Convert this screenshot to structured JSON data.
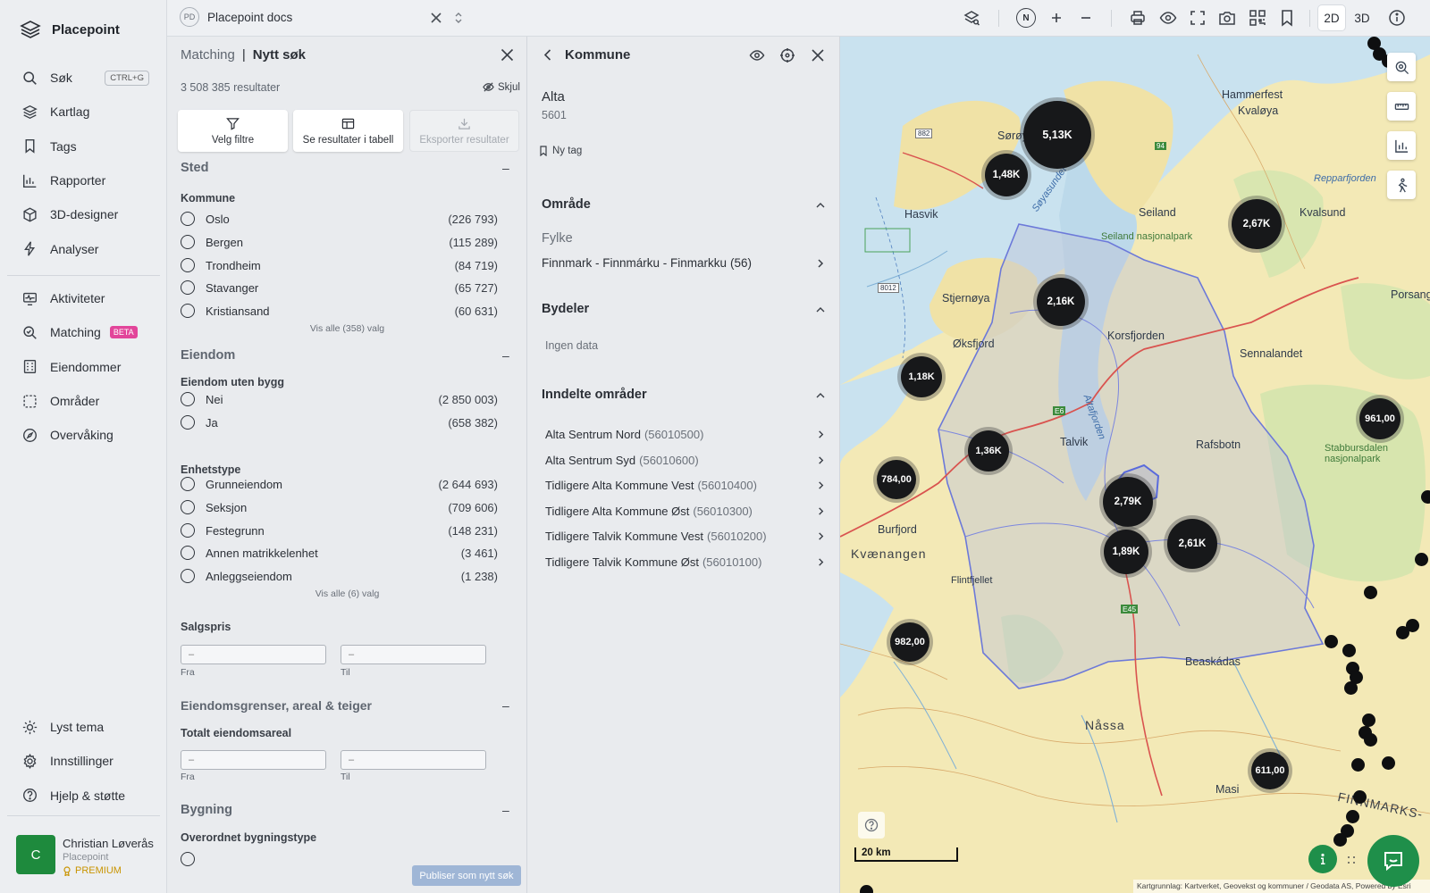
{
  "app": {
    "name": "Placepoint"
  },
  "sidebar": {
    "items": [
      {
        "label": "Søk",
        "icon": "search-icon",
        "shortcut": "CTRL+G"
      },
      {
        "label": "Kartlag",
        "icon": "layers-icon"
      },
      {
        "label": "Tags",
        "icon": "bookmark-icon"
      },
      {
        "label": "Rapporter",
        "icon": "bar-chart-icon"
      },
      {
        "label": "3D-designer",
        "icon": "cube-icon"
      },
      {
        "label": "Analyser",
        "icon": "bolt-icon"
      }
    ],
    "items2": [
      {
        "label": "Aktiviteter",
        "icon": "monitor-pulse-icon"
      },
      {
        "label": "Matching",
        "icon": "search-match-icon",
        "badge": "BETA"
      },
      {
        "label": "Eiendommer",
        "icon": "building-icon"
      },
      {
        "label": "Områder",
        "icon": "dashed-square-icon"
      },
      {
        "label": "Overvåking",
        "icon": "compass-icon"
      }
    ],
    "bottom": [
      {
        "label": "Lyst tema",
        "icon": "sun-icon"
      },
      {
        "label": "Innstillinger",
        "icon": "gear-icon"
      },
      {
        "label": "Hjelp & støtte",
        "icon": "question-circle-icon"
      }
    ],
    "user": {
      "initial": "C",
      "name": "Christian Løverås",
      "org": "Placepoint",
      "plan": "PREMIUM"
    }
  },
  "topbar": {
    "tab": {
      "badge": "PD",
      "title": "Placepoint docs"
    },
    "north_label": "N",
    "dim_2d": "2D",
    "dim_3d": "3D"
  },
  "matching": {
    "title_a": "Matching",
    "separator": "|",
    "title_b": "Nytt søk",
    "count": "3 508 385 resultater",
    "hide_label": "Skjul",
    "actions": [
      "Velg filtre",
      "Se resultater i tabell",
      "Eksporter resultater"
    ],
    "sections": {
      "sted": "Sted",
      "eiendom": "Eiendom",
      "grenser": "Eiendomsgrenser, areal & teiger",
      "bygning": "Bygning"
    },
    "collapse_symbol": "–",
    "kommune": {
      "label": "Kommune",
      "options": [
        {
          "name": "Oslo",
          "count": "(226 793)"
        },
        {
          "name": "Bergen",
          "count": "(115 289)"
        },
        {
          "name": "Trondheim",
          "count": "(84 719)"
        },
        {
          "name": "Stavanger",
          "count": "(65 727)"
        },
        {
          "name": "Kristiansand",
          "count": "(60 631)"
        }
      ],
      "more": "Vis alle (358) valg"
    },
    "uten_bygg": {
      "label": "Eiendom uten bygg",
      "options": [
        {
          "name": "Nei",
          "count": "(2 850 003)"
        },
        {
          "name": "Ja",
          "count": "(658 382)"
        }
      ]
    },
    "enhetstype": {
      "label": "Enhetstype",
      "options": [
        {
          "name": "Grunneiendom",
          "count": "(2 644 693)"
        },
        {
          "name": "Seksjon",
          "count": "(709 606)"
        },
        {
          "name": "Festegrunn",
          "count": "(148 231)"
        },
        {
          "name": "Annen matrikkelenhet",
          "count": "(3 461)"
        },
        {
          "name": "Anleggseiendom",
          "count": "(1 238)"
        }
      ],
      "more": "Vis alle (6) valg"
    },
    "salgspris": {
      "label": "Salgspris",
      "from_placeholder": "–",
      "to_placeholder": "–",
      "from": "Fra",
      "to": "Til"
    },
    "areal": {
      "label": "Totalt eiendomsareal",
      "from_placeholder": "–",
      "to_placeholder": "–",
      "from": "Fra",
      "to": "Til"
    },
    "bygning_sub": "Overordnet bygningstype",
    "publish": "Publiser som nytt søk"
  },
  "kommune_panel": {
    "title": "Kommune",
    "name": "Alta",
    "code": "5601",
    "tag": "Ny tag",
    "omrade": {
      "label": "Område",
      "fylke_label": "Fylke",
      "fylke": "Finnmark - Finnmárku - Finmarkku",
      "fylke_code": "(56)"
    },
    "bydeler": {
      "label": "Bydeler",
      "empty": "Ingen data"
    },
    "inndelte": {
      "label": "Inndelte områder",
      "items": [
        {
          "name": "Alta Sentrum Nord",
          "code": "(56010500)"
        },
        {
          "name": "Alta Sentrum Syd",
          "code": "(56010600)"
        },
        {
          "name": "Tidligere Alta Kommune Vest",
          "code": "(56010400)"
        },
        {
          "name": "Tidligere Alta Kommune Øst",
          "code": "(56010300)"
        },
        {
          "name": "Tidligere Talvik Kommune Vest",
          "code": "(56010200)"
        },
        {
          "name": "Tidligere Talvik Kommune Øst",
          "code": "(56010100)"
        }
      ]
    }
  },
  "map": {
    "clusters": [
      {
        "label": "5,13K"
      },
      {
        "label": "1,48K"
      },
      {
        "label": "2,67K"
      },
      {
        "label": "2,16K"
      },
      {
        "label": "1,18K"
      },
      {
        "label": "961,00"
      },
      {
        "label": "1,36K"
      },
      {
        "label": "784,00"
      },
      {
        "label": "2,79K"
      },
      {
        "label": "2,61K"
      },
      {
        "label": "1,89K"
      },
      {
        "label": "982,00"
      },
      {
        "label": "611,00"
      }
    ],
    "labels": {
      "hammerfest": "Hammerfest",
      "kvaloya": "Kvaløya",
      "seiland": "Seiland",
      "seiland_np": "Seiland nasjonalpark",
      "stjernoya": "Stjernøya",
      "hasvik": "Hasvik",
      "korsfjorden": "Korsfjorden",
      "sennalandet": "Sennalandet",
      "talvik": "Talvik",
      "rafsbotn": "Rafsbotn",
      "altafjorden": "Altafjorden",
      "kvaenangen": "Kvænangen",
      "burfjord": "Burfjord",
      "flintfjellet": "Flintfjellet",
      "nassa": "Nåssa",
      "beaskadas": "Beaskádas",
      "masi": "Masi",
      "stabbursdalen": "Stabbursdalen nasjonalpark",
      "finnmarksvidda": "FINNMARKS-",
      "soroya": "Sørøya",
      "sammenholdet": "Søyasundet",
      "reppar": "Repparfjorden",
      "porsang": "Porsang",
      "kvalsund": "Kvalsund",
      "oksfjord": "Øksfjord",
      "e6": "E6",
      "e45": "E45",
      "r8012": "8012",
      "r882": "882",
      "r94": "94"
    },
    "scale": "20 km",
    "attribution": "Kartgrunnlag: Kartverket, Geovekst og kommuner / Geodata AS, Powered by Esri"
  },
  "colors": {
    "accent": "#1f8f4a",
    "beta": "#e2459a",
    "premium": "#c99400",
    "publish": "#9fb6d6"
  }
}
